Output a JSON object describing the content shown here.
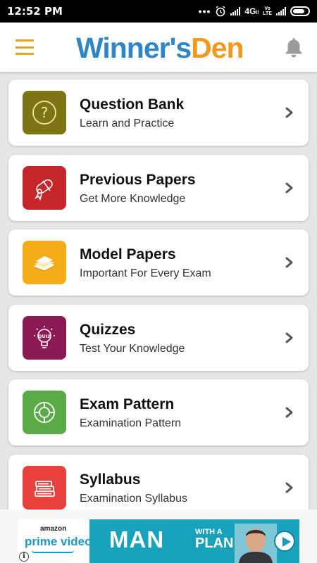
{
  "status_bar": {
    "time": "12:52 PM",
    "network": "4G",
    "network_suffix": "ll",
    "volte_top": "Vo",
    "volte_bottom": "LTE"
  },
  "app": {
    "title_part1": "Winner's",
    "title_part2": "Den"
  },
  "colors": {
    "brand_blue": "#2e86c9",
    "brand_orange": "#f29a1f",
    "menu_icon": "#e8a21a",
    "bell_icon": "#9b9b9b"
  },
  "menu_items": [
    {
      "title": "Question Bank",
      "subtitle": "Learn and Practice",
      "icon": "question-icon",
      "color": "#7d7416"
    },
    {
      "title": "Previous Papers",
      "subtitle": "Get More Knowledge",
      "icon": "scroll-icon",
      "color": "#c4262a"
    },
    {
      "title": "Model Papers",
      "subtitle": "Important For Every Exam",
      "icon": "papers-icon",
      "color": "#f4ad18"
    },
    {
      "title": "Quizzes",
      "subtitle": "Test Your Knowledge",
      "icon": "quiz-bulb-icon",
      "color": "#8b1a55"
    },
    {
      "title": "Exam Pattern",
      "subtitle": "Examination Pattern",
      "icon": "pattern-icon",
      "color": "#5aab48"
    },
    {
      "title": "Syllabus",
      "subtitle": "Examination Syllabus",
      "icon": "books-icon",
      "color": "#e8403c"
    }
  ],
  "ad": {
    "brand_small": "amazon",
    "product": "prime video",
    "headline": "MAN",
    "with": "WITH A",
    "plan": "PLAN",
    "info_glyph": "i"
  }
}
